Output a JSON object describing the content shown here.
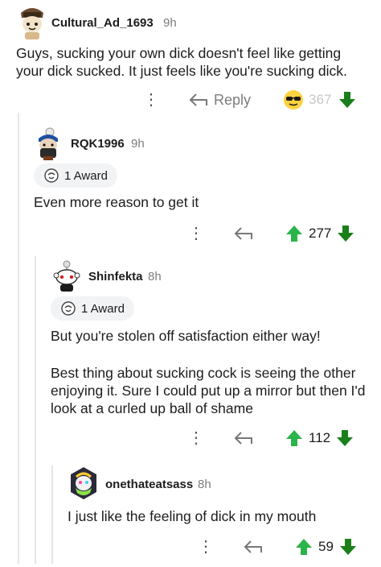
{
  "comments": [
    {
      "username": "Cultural_Ad_1693",
      "time": "9h",
      "body": "Guys, sucking your own dick doesn't feel like getting your dick sucked. It just feels like you're sucking dick.",
      "reply_label": "Reply",
      "vote_count": "367",
      "upvote_color": "#2bb44a",
      "downvote_color": "#1e8c1e"
    },
    {
      "username": "RQK1996",
      "time": "9h",
      "award": "1 Award",
      "body": "Even more reason to get it",
      "vote_count": "277"
    },
    {
      "username": "Shinfekta",
      "time": "8h",
      "award": "1 Award",
      "body_p1": "But you're stolen off satisfaction either way!",
      "body_p2": "Best thing about sucking cock is seeing the other enjoying it. Sure I could put up a mirror but then I'd look at a curled up ball of shame",
      "vote_count": "112"
    },
    {
      "username": "onethateatsass",
      "time": "8h",
      "body": "I just like the feeling of dick in my mouth",
      "vote_count": "59"
    }
  ],
  "icons": {
    "more": "more-options-icon",
    "reply": "reply-arrow-icon",
    "upvote": "upvote-arrow-icon",
    "downvote": "downvote-arrow-icon",
    "award": "award-icon",
    "sunglasses": "sunglasses-emoji-icon"
  }
}
